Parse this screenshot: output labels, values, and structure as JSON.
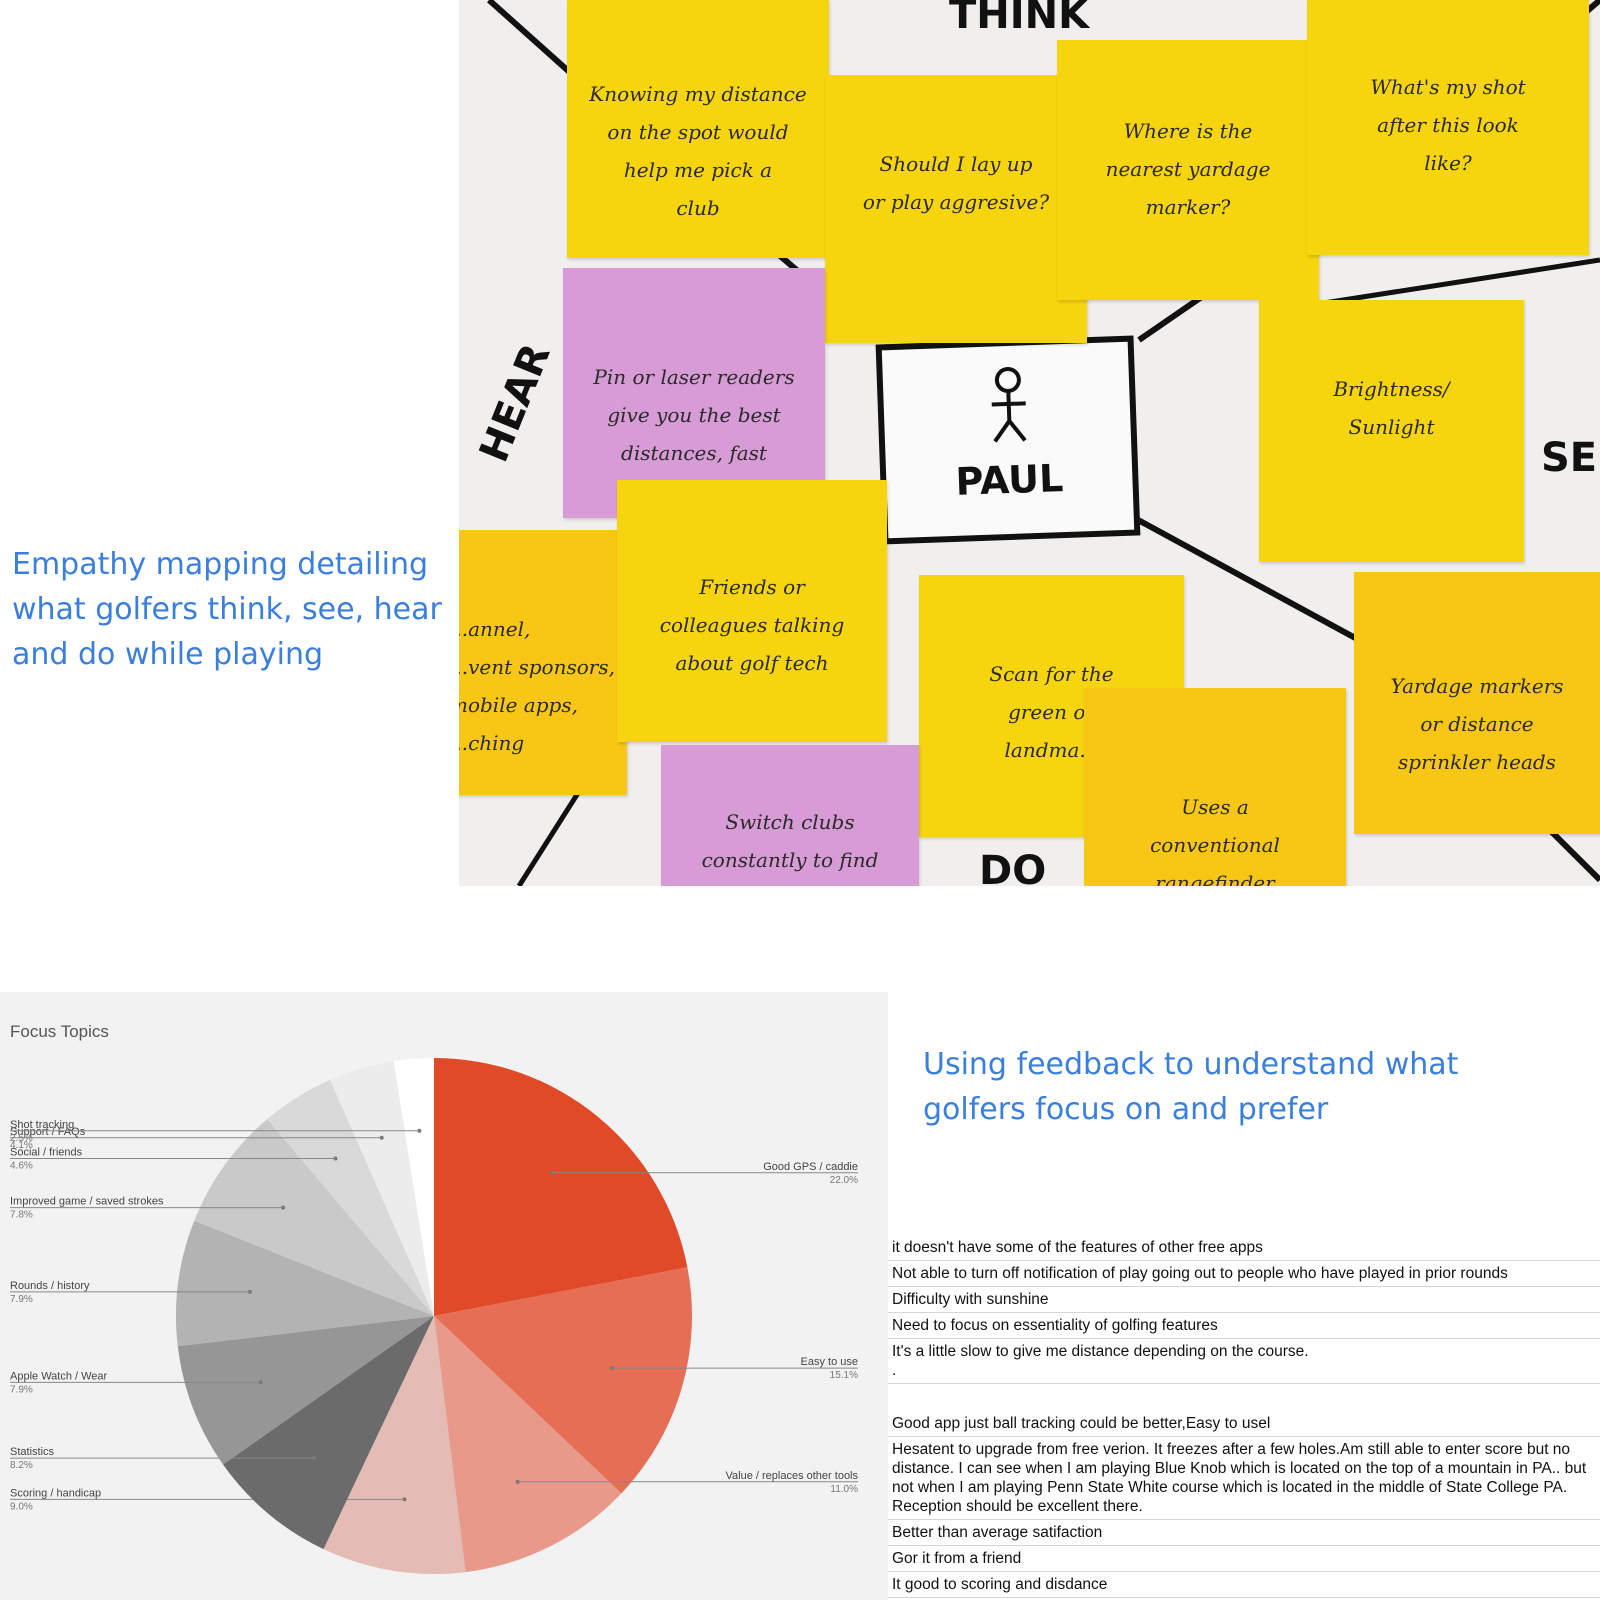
{
  "captions": {
    "empathy": "Empathy mapping detailing what golfers think, see, hear and do while playing",
    "feedback": "Using feedback to understand what golfers focus on and prefer"
  },
  "empathy_map": {
    "labels": {
      "think": "THINK",
      "hear": "HEAR",
      "see": "SEE",
      "do": "DO"
    },
    "persona": "PAUL",
    "notes": [
      "Knowing my distance\non the spot would\nhelp me pick a\nclub",
      "Should I lay up\nor play aggresive?",
      "Where is the\nnearest yardage\nmarker?",
      "What's my shot\nafter this look\nlike?",
      "Pin or laser readers\ngive you the best\ndistances, fast",
      "Brightness/\nSunlight",
      "...annel,\n...vent sponsors,\nmobile apps,\n...ching",
      "Friends or\ncolleagues talking\nabout golf tech",
      "Scan for the\ngreen or\nlandma...",
      "Uses a\nconventional\nrangefinder",
      "Yardage markers\nor distance\nsprinkler heads",
      "Switch clubs\nconstantly to find"
    ]
  },
  "chart_data": {
    "type": "pie",
    "title": "Focus Topics",
    "colors": {
      "Good GPS / caddie": "#e04a28",
      "Easy to use": "#e56e55",
      "Value / replaces other tools": "#e8998a",
      "Scoring / handicap": "#e4bcb4",
      "Statistics": "#6b6b6b",
      "Apple Watch / Wear": "#969696",
      "Rounds / history": "#b3b3b3",
      "Improved game / saved strokes": "#c9c9c9",
      "Social / friends": "#d9d9d9",
      "Support / FAQs": "#ececec",
      "Shot tracking": "#ffffff"
    },
    "slices": [
      {
        "label": "Good GPS / caddie",
        "value": 22.0,
        "pct": "22.0%"
      },
      {
        "label": "Easy to use",
        "value": 15.1,
        "pct": "15.1%"
      },
      {
        "label": "Value / replaces other tools",
        "value": 11.0,
        "pct": "11.0%"
      },
      {
        "label": "Scoring / handicap",
        "value": 9.0,
        "pct": "9.0%"
      },
      {
        "label": "Statistics",
        "value": 8.2,
        "pct": "8.2%"
      },
      {
        "label": "Apple Watch / Wear",
        "value": 7.9,
        "pct": "7.9%"
      },
      {
        "label": "Rounds / history",
        "value": 7.9,
        "pct": "7.9%"
      },
      {
        "label": "Improved game / saved strokes",
        "value": 7.8,
        "pct": "7.8%"
      },
      {
        "label": "Social / friends",
        "value": 4.6,
        "pct": "4.6%"
      },
      {
        "label": "Support / FAQs",
        "value": 4.1,
        "pct": "4.1%"
      },
      {
        "label": "Shot tracking",
        "value": 2.5,
        "pct": "2.5%"
      }
    ]
  },
  "feedback": [
    "it doesn't have some of the features of other free apps",
    "Not able to turn off notification of play going out to people who have played in prior rounds",
    "Difficulty with sunshine",
    "Need to focus on essentiality of golfing features",
    "It's a little slow to give me distance depending on the course.\n.",
    "Good app just ball tracking could be better,Easy to usel",
    "Hesatent to upgrade from free verion.  It freezes after a few holes.Am still able to  enter score but no distance.   I can see when I am playing Blue Knob which is located on the top of a mountain in PA.. but not when I am playing Penn State White course which is located  in the middle of State College PA. Reception should be excellent there.",
    "Better than average satifaction",
    "Gor it from a friend",
    "It good to scoring and disdance"
  ]
}
